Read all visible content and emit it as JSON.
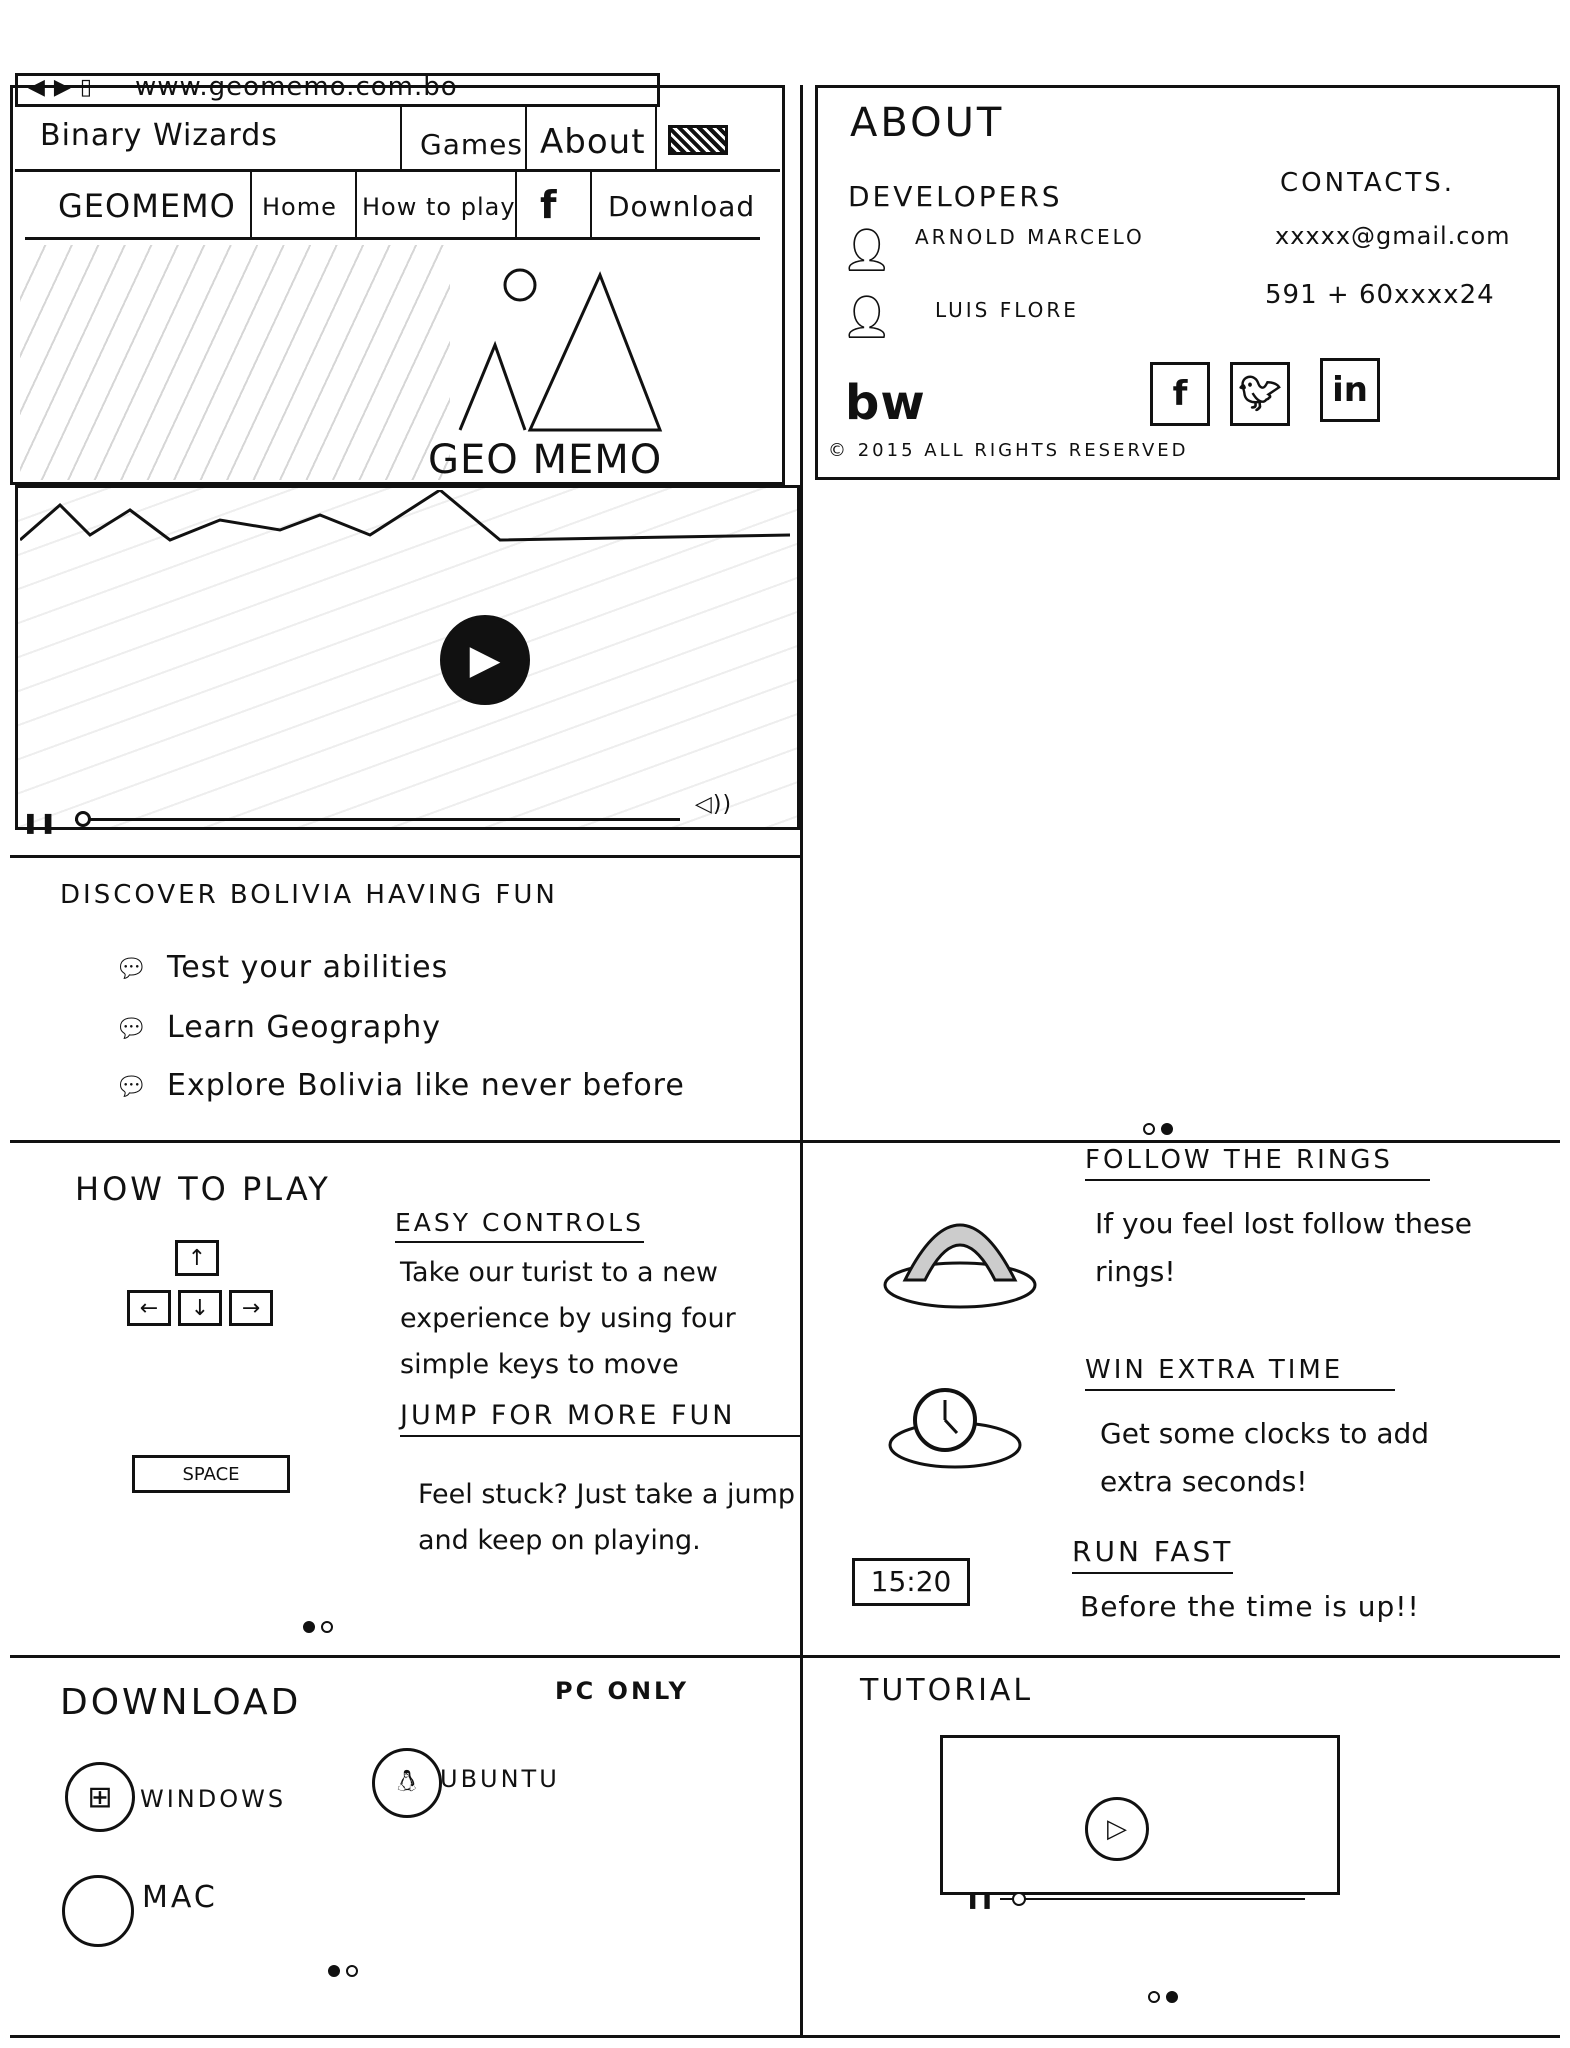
{
  "browser": {
    "url": "www.geomemo.com.bo"
  },
  "header": {
    "brand": "Binary Wizards",
    "nav": [
      "Games",
      "About"
    ]
  },
  "subnav": {
    "logo": "GEOMEMO",
    "items": [
      "Home",
      "How to play",
      "f",
      "Download"
    ]
  },
  "hero": {
    "logo_text": "GEO MEMO"
  },
  "discover": {
    "title": "Discover Bolivia having fun",
    "items": [
      "Test your abilities",
      "Learn Geography",
      "Explore Bolivia like never before"
    ]
  },
  "how_to_play": {
    "title": "How to play",
    "space_key": "SPACE",
    "sections": [
      {
        "title": "Easy controls",
        "text": "Take our turist to a new experience by using four simple keys to move"
      },
      {
        "title": "Jump for more fun",
        "text": "Feel stuck? Just take a jump and keep on playing."
      }
    ]
  },
  "features": [
    {
      "title": "Follow the rings",
      "text": "If you feel lost follow these rings!"
    },
    {
      "title": "Win extra time",
      "text": "Get some clocks to add extra seconds!"
    },
    {
      "title": "Run fast",
      "text": "Before the time is up!!"
    }
  ],
  "timer": "15:20",
  "about": {
    "title": "About",
    "developers_title": "Developers",
    "developers": [
      "Arnold Marcelo",
      "Luis Flore"
    ],
    "contacts_title": "Contacts.",
    "email": "xxxxx@gmail.com",
    "phone": "591 + 60xxxx24",
    "logo_text": "bw",
    "copyright": "© 2015 All rights reserved"
  },
  "download": {
    "title": "Download",
    "note": "PC only",
    "platforms": [
      "Windows",
      "Ubuntu",
      "Mac"
    ]
  },
  "tutorial": {
    "title": "Tutorial"
  }
}
